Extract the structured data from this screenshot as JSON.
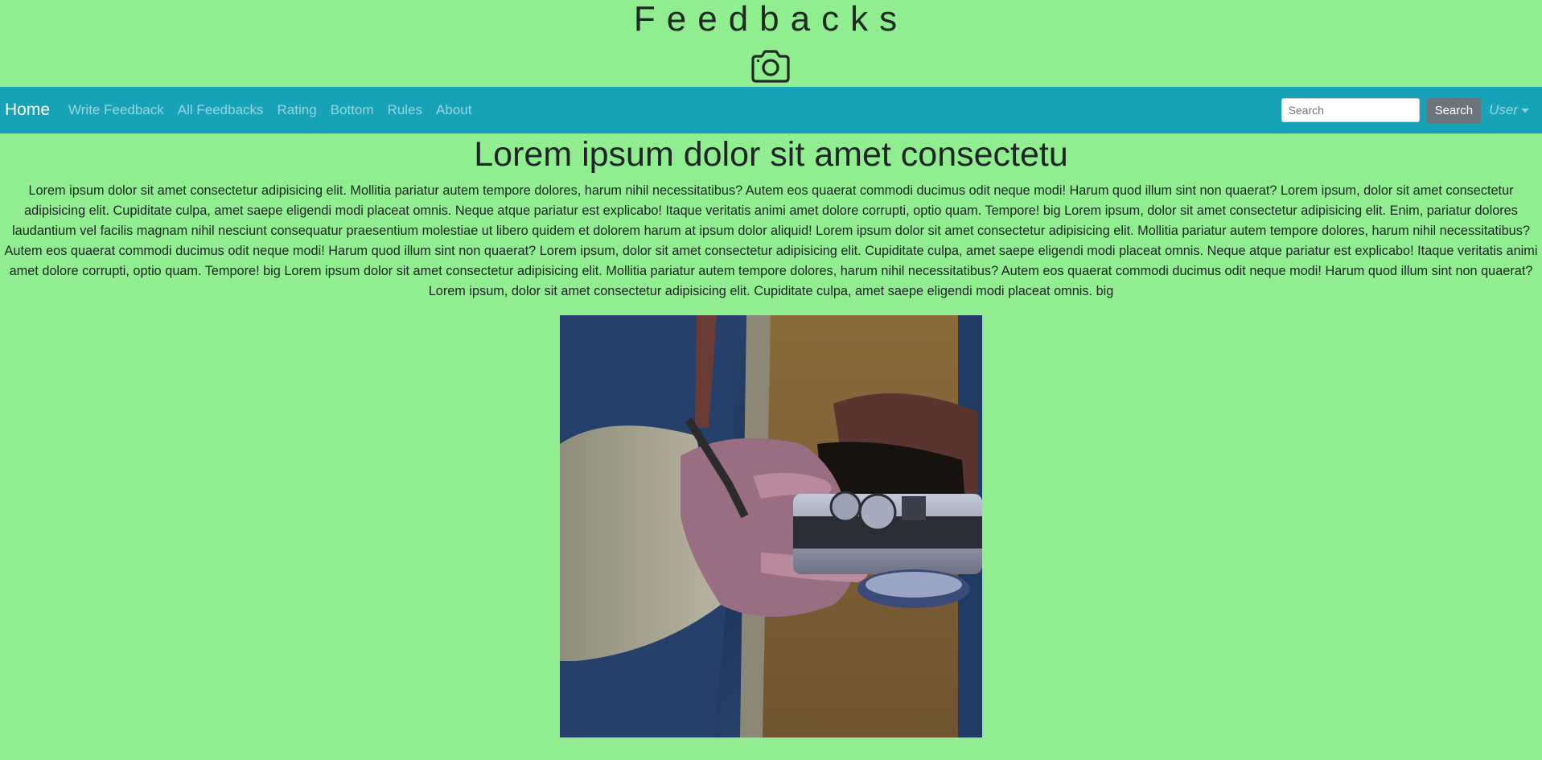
{
  "header": {
    "title": "Feedbacks",
    "logo_icon": "camera-icon"
  },
  "navbar": {
    "brand": "Home",
    "links": [
      "Write Feedback",
      "All Feedbacks",
      "Rating",
      "Bottom",
      "Rules",
      "About"
    ],
    "search_placeholder": "Search",
    "search_button": "Search",
    "user_menu": "User",
    "background_color": "#17a2b8"
  },
  "main": {
    "heading": "Lorem ipsum dolor sit amet consectetu",
    "paragraph": "Lorem ipsum dolor sit amet consectetur adipisicing elit. Mollitia pariatur autem tempore dolores, harum nihil necessitatibus? Autem eos quaerat commodi ducimus odit neque modi! Harum quod illum sint non quaerat? Lorem ipsum, dolor sit amet consectetur adipisicing elit. Cupiditate culpa, amet saepe eligendi modi placeat omnis. Neque atque pariatur est explicabo! Itaque veritatis animi amet dolore corrupti, optio quam. Tempore! big Lorem ipsum, dolor sit amet consectetur adipisicing elit. Enim, pariatur dolores laudantium vel facilis magnam nihil nesciunt consequatur praesentium molestiae ut libero quidem et dolorem harum at ipsum dolor aliquid! Lorem ipsum dolor sit amet consectetur adipisicing elit. Mollitia pariatur autem tempore dolores, harum nihil necessitatibus? Autem eos quaerat commodi ducimus odit neque modi! Harum quod illum sint non quaerat? Lorem ipsum, dolor sit amet consectetur adipisicing elit. Cupiditate culpa, amet saepe eligendi modi placeat omnis. Neque atque pariatur est explicabo! Itaque veritatis animi amet dolore corrupti, optio quam. Tempore! big Lorem ipsum dolor sit amet consectetur adipisicing elit. Mollitia pariatur autem tempore dolores, harum nihil necessitatibus? Autem eos quaerat commodi ducimus odit neque modi! Harum quod illum sint non quaerat? Lorem ipsum, dolor sit amet consectetur adipisicing elit. Cupiditate culpa, amet saepe eligendi modi placeat omnis. big",
    "image_icon": "camera-photo"
  },
  "colors": {
    "page_background": "#90ee90",
    "accent": "#17a2b8",
    "button_gray": "#6c757d"
  }
}
